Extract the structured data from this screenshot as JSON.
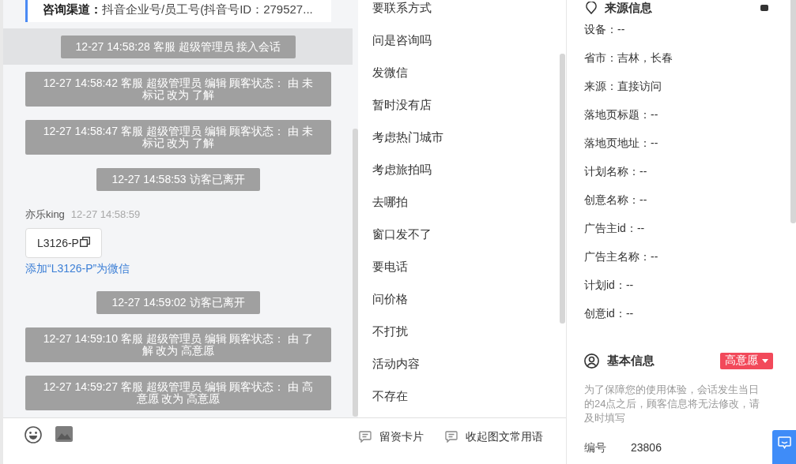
{
  "chat": {
    "channel_card": {
      "text": "**咨询渠道：**抖音企业号/员工号(抖音号ID：279527..."
    },
    "messages": [
      {
        "kind": "system",
        "text": "12-27 14:58:28 客服 超级管理员 接入会话",
        "highlighted": true
      },
      {
        "kind": "system",
        "text": "12-27 14:58:42 客服 超级管理员 编辑 顾客状态： 由 未标记 改为 了解",
        "highlighted": false
      },
      {
        "kind": "system",
        "text": "12-27 14:58:47 客服 超级管理员 编辑 顾客状态： 由 未标记 改为 了解",
        "highlighted": false
      },
      {
        "kind": "system",
        "text": "12-27 14:58:53 访客已离开",
        "highlighted": false
      },
      {
        "kind": "visitor",
        "sender": "亦乐king",
        "time": "12-27 14:58:59",
        "card_text": "L3126-P",
        "link": "添加“L3126-P”为微信"
      },
      {
        "kind": "system",
        "text": "12-27 14:59:02 访客已离开",
        "highlighted": false
      },
      {
        "kind": "system",
        "text": "12-27 14:59:10 客服 超级管理员 编辑 顾客状态： 由 了解 改为 高意愿",
        "highlighted": false
      },
      {
        "kind": "system",
        "text": "12-27 14:59:27 客服 超级管理员 编辑 顾客状态： 由 高意愿 改为 高意愿",
        "highlighted": false
      }
    ]
  },
  "quick_replies": {
    "items": [
      "要联系方式",
      "问是咨询吗",
      "发微信",
      "暂时没有店",
      "考虑热门城市",
      "考虑旅拍吗",
      "去哪拍",
      "窗口发不了",
      "要电话",
      "问价格",
      "不打扰",
      "活动内容",
      "不存在"
    ],
    "actions": [
      {
        "label": "留资卡片"
      },
      {
        "label": "收起图文常用语"
      }
    ]
  },
  "source_info": {
    "title": "来源信息",
    "lines": [
      "设备：--",
      "省市：吉林，长春",
      "来源：直接访问",
      "落地页标题：--",
      "落地页地址：--",
      "计划名称：--",
      "创意名称：--",
      "广告主id：--",
      "广告主名称：--",
      "计划id：--",
      "创意id：--"
    ]
  },
  "basic_info": {
    "title": "基本信息",
    "status": "高意愿",
    "note": "为了保障您的使用体验，会话发生当日的24点之后，顾客信息将无法修改，请及时填写",
    "fields": [
      {
        "label": "编号",
        "value": "23806"
      }
    ]
  }
}
